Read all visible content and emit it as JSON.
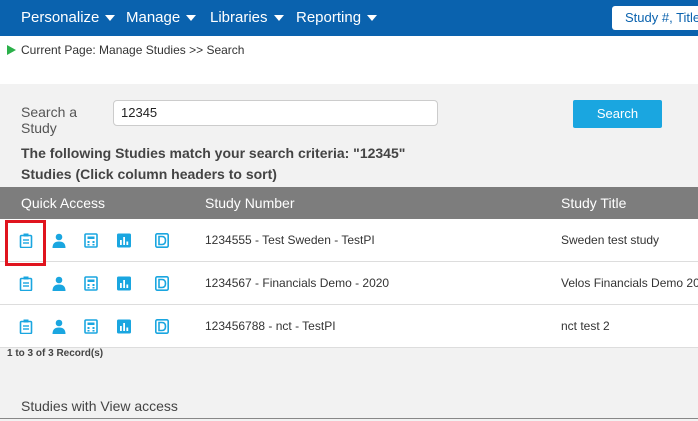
{
  "nav": {
    "items": [
      "Personalize",
      "Manage",
      "Libraries",
      "Reporting"
    ],
    "search_placeholder": "Study #, Title"
  },
  "breadcrumb": "Current Page: Manage Studies >> Search",
  "search": {
    "label": "Search a Study",
    "value": "12345",
    "button": "Search"
  },
  "results": {
    "match_text": "The following Studies match your search criteria: \"12345\"",
    "title": "Studies (Click column headers to sort)",
    "columns": [
      "Quick Access",
      "Study Number",
      "Study Title"
    ],
    "rows": [
      {
        "number": "1234555 - Test Sweden - TestPI",
        "title": "Sweden test study"
      },
      {
        "number": "1234567 - Financials Demo - 2020",
        "title": "Velos Financials Demo 20"
      },
      {
        "number": "123456788 - nct - TestPI",
        "title": "nct test 2"
      }
    ],
    "record_count": "1 to 3 of 3 Record(s)"
  },
  "view_access_title": "Studies with View access",
  "colors": {
    "nav_bg": "#0a62ae",
    "icon_blue": "#1aa6e0",
    "search_button": "#1aa6e0",
    "header_gray": "#7d7d7d",
    "highlight_red": "#e0141e"
  },
  "quick_access_icons": [
    "clipboard-icon",
    "person-icon",
    "calculator-icon",
    "chart-icon",
    "document-d-icon"
  ]
}
